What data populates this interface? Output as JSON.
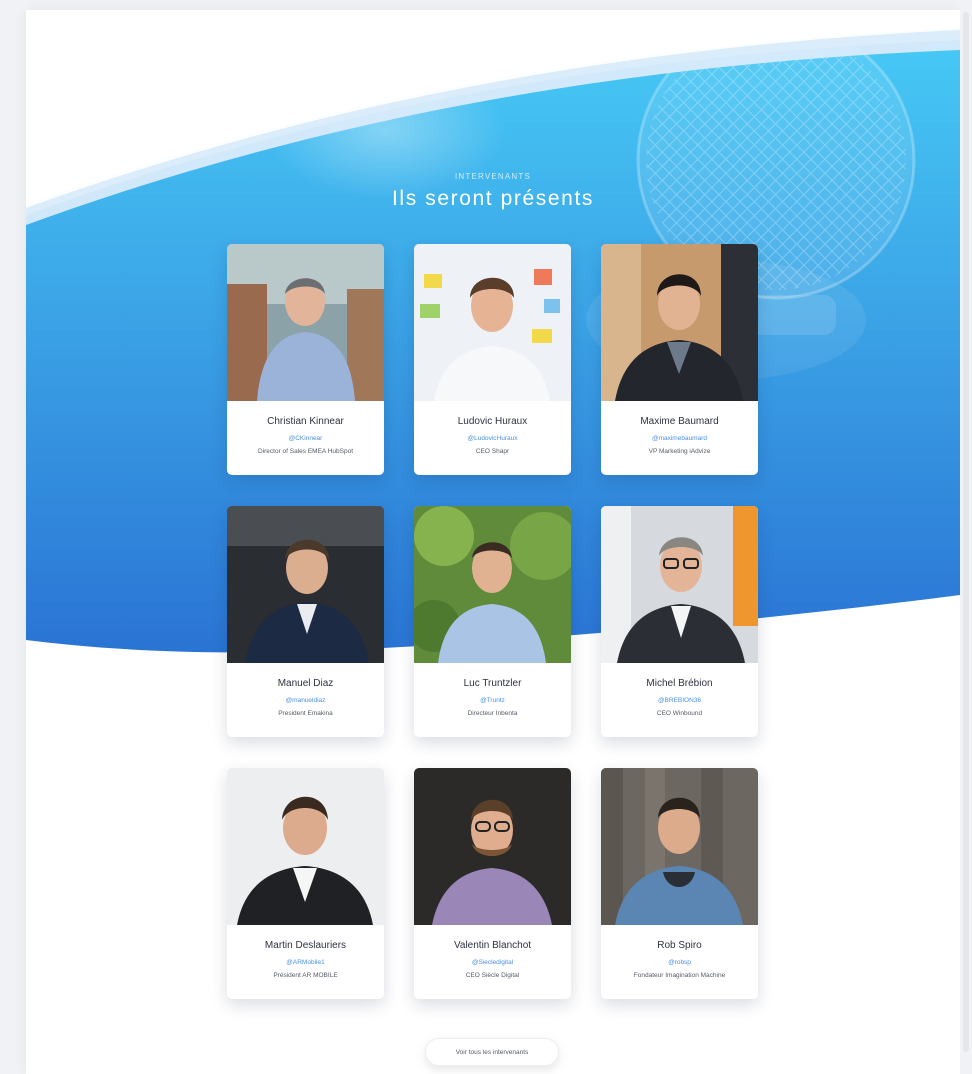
{
  "colors": {
    "hero_top": "#43c5f4",
    "hero_bottom": "#2a7fd8",
    "handle": "#4a90e2",
    "name": "#2d3240",
    "role": "#555b66"
  },
  "section": {
    "eyebrow": "INTERVENANTS",
    "title": "Ils seront présents"
  },
  "speakers": [
    {
      "name": "Christian Kinnear",
      "handle": "@CKinnear",
      "role": "Director of Sales EMEA HubSpot"
    },
    {
      "name": "Ludovic Huraux",
      "handle": "@LudovicHuraux",
      "role": "CEO Shapr"
    },
    {
      "name": "Maxime Baumard",
      "handle": "@maximebaumard",
      "role": "VP Marketing iAdvize"
    },
    {
      "name": "Manuel Diaz",
      "handle": "@manueldiaz",
      "role": "President Emakina"
    },
    {
      "name": "Luc Truntzler",
      "handle": "@Truntz",
      "role": "Directeur Inbenta"
    },
    {
      "name": "Michel Brébion",
      "handle": "@BREBION36",
      "role": "CEO Winbound"
    },
    {
      "name": "Martin Deslauriers",
      "handle": "@ARMobile1",
      "role": "Président AR MOBILE"
    },
    {
      "name": "Valentin Blanchot",
      "handle": "@Siecledigital",
      "role": "CEO Siècle Digital"
    },
    {
      "name": "Rob Spiro",
      "handle": "@robsp",
      "role": "Fondateur Imagination Machine"
    }
  ],
  "cta": {
    "label": "Voir tous les intervenants"
  }
}
